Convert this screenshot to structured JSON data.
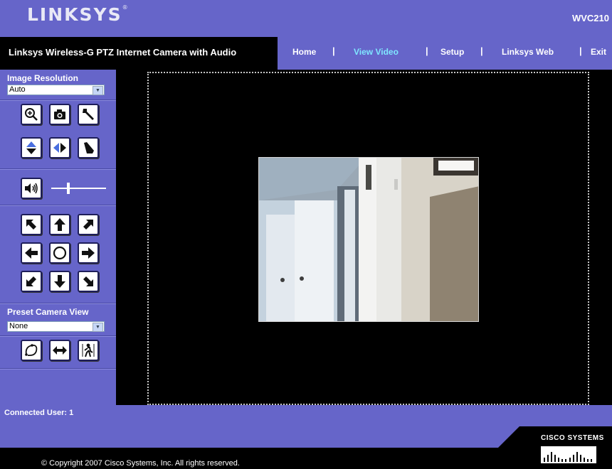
{
  "header": {
    "logo": "Linksys",
    "model": "WVC210"
  },
  "title": "Linksys Wireless-G PTZ Internet Camera with Audio",
  "nav": [
    {
      "label": "Home"
    },
    {
      "label": "View Video",
      "active": true
    },
    {
      "label": "Setup"
    },
    {
      "label": "Linksys Web"
    },
    {
      "label": "Exit"
    }
  ],
  "nav_separator": "|",
  "sidebar": {
    "resolution_label": "Image Resolution",
    "resolution_value": "Auto",
    "preset_label": "Preset Camera View",
    "preset_value": "None",
    "volume_level": 0.3
  },
  "footer": {
    "connected_users": "Connected User: 1",
    "copyright": "© Copyright 2007 Cisco Systems, Inc. All rights reserved.",
    "brand": "Cisco Systems"
  },
  "colors": {
    "theme": "#6665c9",
    "active_nav": "#7fe6ff"
  }
}
